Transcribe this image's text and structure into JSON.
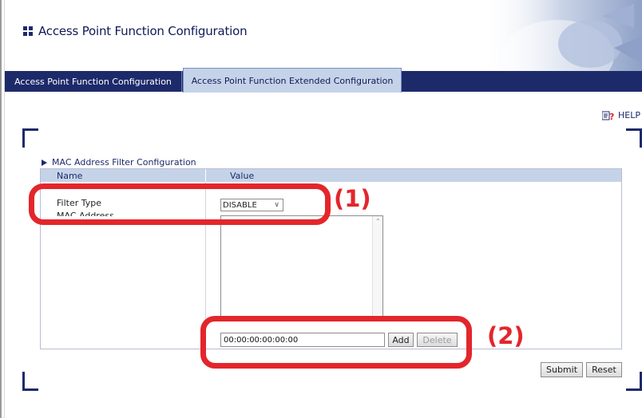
{
  "header": {
    "title": "Access Point Function Configuration"
  },
  "nav": {
    "tabs": [
      {
        "label": "Access Point Function Configuration",
        "active": false
      },
      {
        "label": "Access Point Function Extended Configuration",
        "active": true
      }
    ]
  },
  "help": {
    "label": "HELP"
  },
  "section": {
    "title": "MAC Address Filter Configuration",
    "columns": {
      "name": "Name",
      "value": "Value"
    },
    "rows": {
      "filter_type_label": "Filter Type",
      "mac_list_label": "MAC Address"
    },
    "filter_type": {
      "selected": "DISABLE"
    },
    "mac_input_value": "00:00:00:00:00:00",
    "add_label": "Add",
    "delete_label": "Delete"
  },
  "footer": {
    "submit_label": "Submit",
    "reset_label": "Reset"
  },
  "callouts": {
    "one": "(1)",
    "two": "(2)"
  },
  "colors": {
    "nav_bg": "#1d2a6a",
    "active_tab_bg": "#c5d3e9",
    "table_header_bg": "#c5d3e9",
    "callout_red": "#e3262b"
  },
  "icons": [
    "grid-icon",
    "help-icon",
    "triangle-right-icon",
    "chevron-down-icon",
    "scroll-up-icon"
  ]
}
